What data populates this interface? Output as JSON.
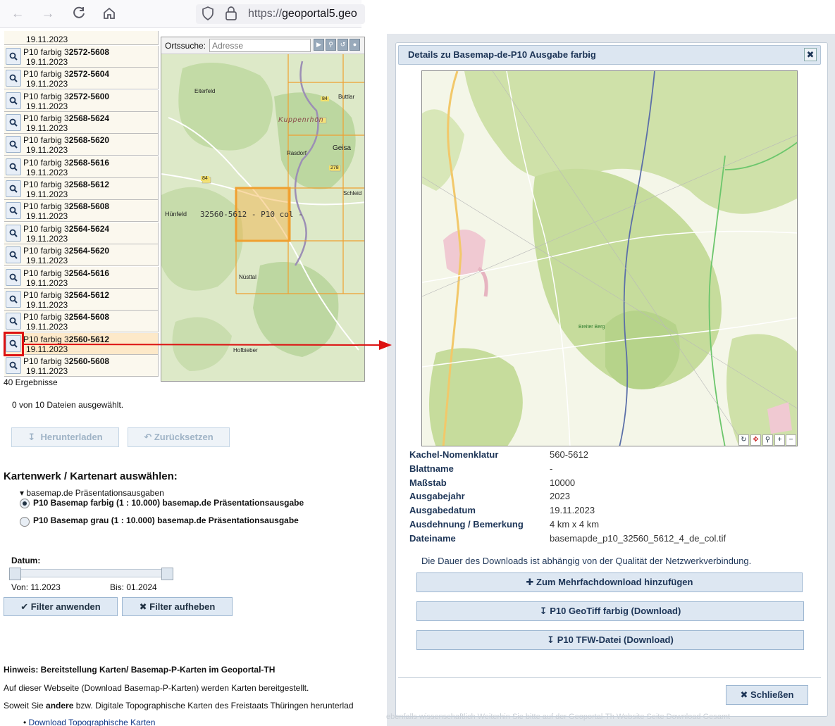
{
  "browser": {
    "url_prefix": "https://",
    "url_host": "geoportal5.geo"
  },
  "results": {
    "top_date": "19.11.2023",
    "items": [
      {
        "prefix": "P10 farbig 3",
        "code": "2572-5608",
        "date": "19.11.2023"
      },
      {
        "prefix": "P10 farbig 3",
        "code": "2572-5604",
        "date": "19.11.2023"
      },
      {
        "prefix": "P10 farbig 3",
        "code": "2572-5600",
        "date": "19.11.2023"
      },
      {
        "prefix": "P10 farbig 3",
        "code": "2568-5624",
        "date": "19.11.2023"
      },
      {
        "prefix": "P10 farbig 3",
        "code": "2568-5620",
        "date": "19.11.2023"
      },
      {
        "prefix": "P10 farbig 3",
        "code": "2568-5616",
        "date": "19.11.2023"
      },
      {
        "prefix": "P10 farbig 3",
        "code": "2568-5612",
        "date": "19.11.2023"
      },
      {
        "prefix": "P10 farbig 3",
        "code": "2568-5608",
        "date": "19.11.2023"
      },
      {
        "prefix": "P10 farbig 3",
        "code": "2564-5624",
        "date": "19.11.2023"
      },
      {
        "prefix": "P10 farbig 3",
        "code": "2564-5620",
        "date": "19.11.2023"
      },
      {
        "prefix": "P10 farbig 3",
        "code": "2564-5616",
        "date": "19.11.2023"
      },
      {
        "prefix": "P10 farbig 3",
        "code": "2564-5612",
        "date": "19.11.2023"
      },
      {
        "prefix": "P10 farbig 3",
        "code": "2564-5608",
        "date": "19.11.2023"
      },
      {
        "prefix": "P10 farbig 3",
        "code": "2560-5612",
        "date": "19.11.2023"
      },
      {
        "prefix": "P10 farbig 3",
        "code": "2560-5608",
        "date": "19.11.2023"
      }
    ],
    "count": "40 Ergebnisse",
    "selected_info": "0 von 10 Dateien ausgewählt."
  },
  "map": {
    "search_label": "Ortssuche:",
    "search_placeholder": "Adresse",
    "places": {
      "eiterfeld": "Eiterfeld",
      "buttlar": "Buttlar",
      "kuppenrhoen": "Kuppenrhön",
      "rasdorf": "Rasdorf",
      "geisa": "Geisa",
      "schleid": "Schleid",
      "huenfeld": "Hünfeld",
      "nuesttal": "Nüsttal",
      "hofbieber": "Hofbieber"
    },
    "road_labels": {
      "b84a": "84",
      "b84b": "84",
      "b278": "278"
    },
    "tile_label": "32560-5612 -  P10 col -"
  },
  "actions": {
    "download": "Herunterladen",
    "reset": "Zurücksetzen"
  },
  "kartenwerk": {
    "heading": "Kartenwerk / Kartenart auswählen:",
    "group": "▾ basemap.de Präsentationsausgaben",
    "options": [
      "P10 Basemap farbig (1 : 10.000) basemap.de Präsentationsausgabe",
      "P10 Basemap grau (1 : 10.000) basemap.de Präsentationsausgabe"
    ]
  },
  "datum": {
    "label": "Datum:",
    "from": "Von: 11.2023",
    "to": "Bis: 01.2024",
    "apply": "Filter anwenden",
    "clear": "Filter aufheben"
  },
  "hinweis": {
    "title": "Hinweis: Bereitstellung Karten/ Basemap-P-Karten im Geoportal-TH",
    "line1": "Auf dieser Webseite (Download Basemap-P-Karten) werden Karten bereitgestellt.",
    "line2_a": "Soweit Sie ",
    "line2_b": "andere",
    "line2_c": " bzw. Digitale Topographische Karten des Freistaats Thüringen herunterlad",
    "link": "Download Topographische Karten"
  },
  "dialog": {
    "title": "Details zu Basemap-de-P10 Ausgabe farbig",
    "preview_map_label": "Breiter Berg",
    "details": [
      {
        "label": "Kachel-Nomenklatur",
        "value": "560-5612"
      },
      {
        "label": "Blattname",
        "value": "-"
      },
      {
        "label": "Maßstab",
        "value": "10000"
      },
      {
        "label": "Ausgabejahr",
        "value": "2023"
      },
      {
        "label": "Ausgabedatum",
        "value": "19.11.2023"
      },
      {
        "label": "Ausdehnung / Bemerkung",
        "value": "4 km x 4 km"
      },
      {
        "label": "Dateiname",
        "value": "basemapde_p10_32560_5612_4_de_col.tif"
      }
    ],
    "note": "Die Dauer des Downloads ist abhängig von der Qualität der Netzwerkverbindung.",
    "btn_multi": "Zum Mehrfachdownload hinzufügen",
    "btn_geotiff": "P10 GeoTiff farbig (Download)",
    "btn_tfw": "P10 TFW-Datei (Download)",
    "close": "Schließen",
    "bottom_text": "ebenfalls wissenschaftlich Weiterhin Sie bitte auf der Geoportal-Th Website Seite Download Gesamt"
  },
  "colors": {
    "accent": "#1d3557",
    "highlight": "#d11111",
    "tile_orange": "#f0a030"
  }
}
